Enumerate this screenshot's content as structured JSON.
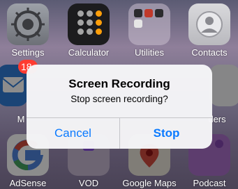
{
  "home": {
    "apps_row1": [
      {
        "label": "Settings"
      },
      {
        "label": "Calculator"
      },
      {
        "label": "Utilities"
      },
      {
        "label": "Contacts"
      }
    ],
    "apps_row2_partial": [
      {
        "label": "M"
      },
      {
        "label": "ders"
      }
    ],
    "badge_partial": "18",
    "apps_row3": [
      {
        "label": "AdSense"
      },
      {
        "label": "VOD"
      },
      {
        "label": "Google Maps"
      },
      {
        "label": "Podcast"
      }
    ]
  },
  "alert": {
    "title": "Screen Recording",
    "message": "Stop screen recording?",
    "cancel_label": "Cancel",
    "stop_label": "Stop"
  },
  "colors": {
    "accent": "#0a7aff"
  }
}
